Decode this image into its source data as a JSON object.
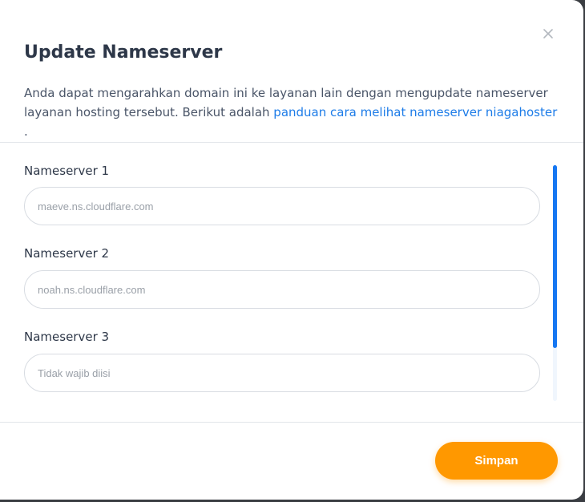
{
  "modal": {
    "title": "Update Nameserver",
    "description_text": "Anda dapat mengarahkan domain ini ke layanan lain dengan mengupdate nameserver layanan hosting tersebut. Berikut adalah ",
    "description_link": "panduan cara melihat nameserver niagahoster",
    "description_end": " .",
    "close_icon": "close-icon"
  },
  "fields": [
    {
      "label": "Nameserver 1",
      "value": "",
      "placeholder": "maeve.ns.cloudflare.com"
    },
    {
      "label": "Nameserver 2",
      "value": "",
      "placeholder": "noah.ns.cloudflare.com"
    },
    {
      "label": "Nameserver 3",
      "value": "",
      "placeholder": "Tidak wajib diisi"
    }
  ],
  "footer": {
    "save_label": "Simpan"
  },
  "colors": {
    "accent": "#ff9800",
    "link": "#1d7ce8",
    "scrollbar": "#1677f2"
  }
}
